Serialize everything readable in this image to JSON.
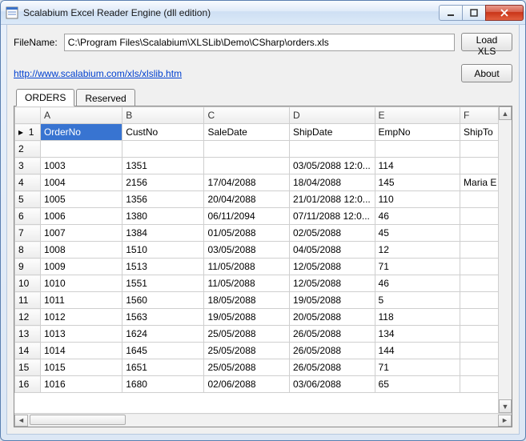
{
  "window": {
    "title": "Scalabium Excel Reader Engine (dll edition)"
  },
  "top": {
    "filename_label": "FileName:",
    "path_value": "C:\\Program Files\\Scalabium\\XLSLib\\Demo\\CSharp\\orders.xls",
    "load_button": "Load XLS",
    "link_text": "http://www.scalabium.com/xls/xlslib.htm",
    "about_button": "About"
  },
  "tabs": [
    {
      "label": "ORDERS",
      "active": true
    },
    {
      "label": "Reserved",
      "active": false
    }
  ],
  "grid": {
    "columns": [
      "A",
      "B",
      "C",
      "D",
      "E",
      "F"
    ],
    "selected": {
      "row": 1,
      "col": "A"
    },
    "current_row": 1,
    "rows": [
      {
        "n": 1,
        "A": "OrderNo",
        "B": "CustNo",
        "C": "SaleDate",
        "D": "ShipDate",
        "E": "EmpNo",
        "F": "ShipTo"
      },
      {
        "n": 2,
        "A": "",
        "B": "",
        "C": "",
        "D": "",
        "E": "",
        "F": ""
      },
      {
        "n": 3,
        "A": "1003",
        "B": "1351",
        "C": "",
        "D": "03/05/2088 12:0...",
        "E": "114",
        "F": ""
      },
      {
        "n": 4,
        "A": "1004",
        "B": "2156",
        "C": "17/04/2088",
        "D": "18/04/2088",
        "E": "145",
        "F": "Maria E"
      },
      {
        "n": 5,
        "A": "1005",
        "B": "1356",
        "C": "20/04/2088",
        "D": "21/01/2088 12:0...",
        "E": "110",
        "F": ""
      },
      {
        "n": 6,
        "A": "1006",
        "B": "1380",
        "C": "06/11/2094",
        "D": "07/11/2088 12:0...",
        "E": "46",
        "F": ""
      },
      {
        "n": 7,
        "A": "1007",
        "B": "1384",
        "C": "01/05/2088",
        "D": "02/05/2088",
        "E": "45",
        "F": ""
      },
      {
        "n": 8,
        "A": "1008",
        "B": "1510",
        "C": "03/05/2088",
        "D": "04/05/2088",
        "E": "12",
        "F": ""
      },
      {
        "n": 9,
        "A": "1009",
        "B": "1513",
        "C": "11/05/2088",
        "D": "12/05/2088",
        "E": "71",
        "F": ""
      },
      {
        "n": 10,
        "A": "1010",
        "B": "1551",
        "C": "11/05/2088",
        "D": "12/05/2088",
        "E": "46",
        "F": ""
      },
      {
        "n": 11,
        "A": "1011",
        "B": "1560",
        "C": "18/05/2088",
        "D": "19/05/2088",
        "E": "5",
        "F": ""
      },
      {
        "n": 12,
        "A": "1012",
        "B": "1563",
        "C": "19/05/2088",
        "D": "20/05/2088",
        "E": "118",
        "F": ""
      },
      {
        "n": 13,
        "A": "1013",
        "B": "1624",
        "C": "25/05/2088",
        "D": "26/05/2088",
        "E": "134",
        "F": ""
      },
      {
        "n": 14,
        "A": "1014",
        "B": "1645",
        "C": "25/05/2088",
        "D": "26/05/2088",
        "E": "144",
        "F": ""
      },
      {
        "n": 15,
        "A": "1015",
        "B": "1651",
        "C": "25/05/2088",
        "D": "26/05/2088",
        "E": "71",
        "F": ""
      },
      {
        "n": 16,
        "A": "1016",
        "B": "1680",
        "C": "02/06/2088",
        "D": "03/06/2088",
        "E": "65",
        "F": ""
      }
    ]
  }
}
